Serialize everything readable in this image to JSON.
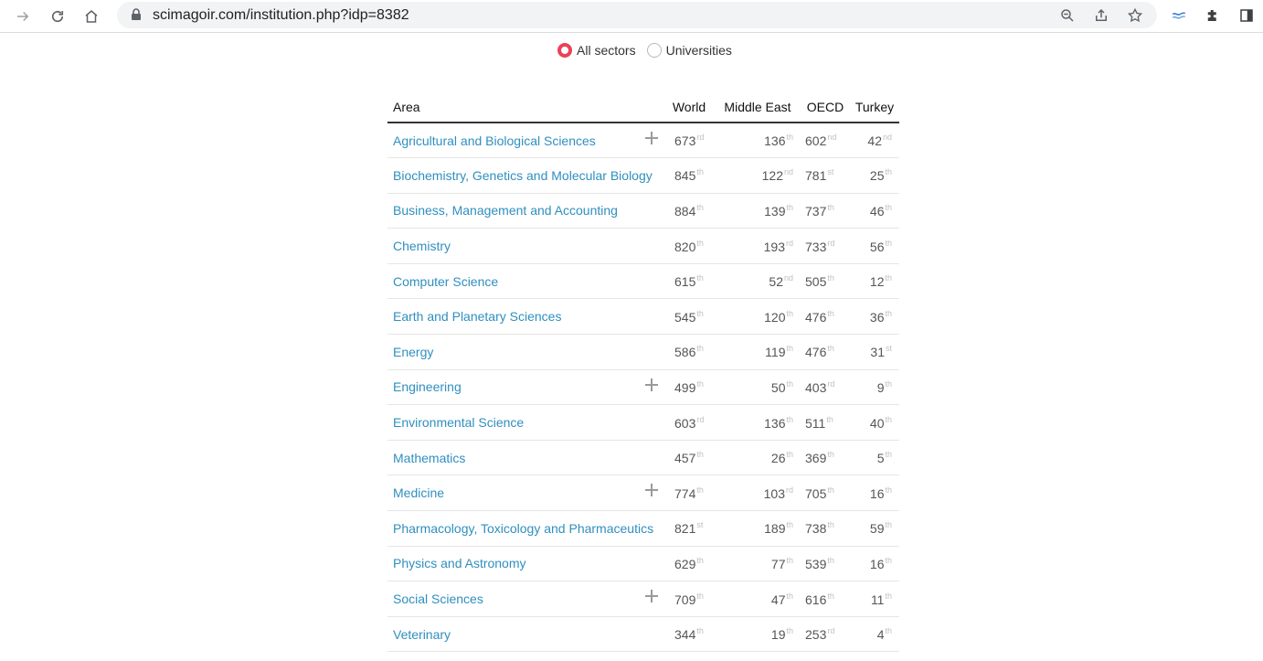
{
  "browser": {
    "url": "scimagoir.com/institution.php?idp=8382"
  },
  "filter": {
    "options": [
      {
        "label": "All sectors",
        "checked": true
      },
      {
        "label": "Universities",
        "checked": false
      }
    ]
  },
  "table": {
    "headers": {
      "area": "Area",
      "world": "World",
      "middle_east": "Middle East",
      "oecd": "OECD",
      "turkey": "Turkey"
    },
    "rows": [
      {
        "area": "Agricultural and Biological Sciences",
        "expand": true,
        "world": "673",
        "world_sfx": "rd",
        "me": "136",
        "me_sfx": "th",
        "oecd": "602",
        "oecd_sfx": "nd",
        "tr": "42",
        "tr_sfx": "nd"
      },
      {
        "area": "Biochemistry, Genetics and Molecular Biology",
        "expand": false,
        "world": "845",
        "world_sfx": "th",
        "me": "122",
        "me_sfx": "nd",
        "oecd": "781",
        "oecd_sfx": "st",
        "tr": "25",
        "tr_sfx": "th"
      },
      {
        "area": "Business, Management and Accounting",
        "expand": false,
        "world": "884",
        "world_sfx": "th",
        "me": "139",
        "me_sfx": "th",
        "oecd": "737",
        "oecd_sfx": "th",
        "tr": "46",
        "tr_sfx": "th"
      },
      {
        "area": "Chemistry",
        "expand": false,
        "world": "820",
        "world_sfx": "th",
        "me": "193",
        "me_sfx": "rd",
        "oecd": "733",
        "oecd_sfx": "rd",
        "tr": "56",
        "tr_sfx": "th"
      },
      {
        "area": "Computer Science",
        "expand": false,
        "world": "615",
        "world_sfx": "th",
        "me": "52",
        "me_sfx": "nd",
        "oecd": "505",
        "oecd_sfx": "th",
        "tr": "12",
        "tr_sfx": "th"
      },
      {
        "area": "Earth and Planetary Sciences",
        "expand": false,
        "world": "545",
        "world_sfx": "th",
        "me": "120",
        "me_sfx": "th",
        "oecd": "476",
        "oecd_sfx": "th",
        "tr": "36",
        "tr_sfx": "th"
      },
      {
        "area": "Energy",
        "expand": false,
        "world": "586",
        "world_sfx": "th",
        "me": "119",
        "me_sfx": "th",
        "oecd": "476",
        "oecd_sfx": "th",
        "tr": "31",
        "tr_sfx": "st"
      },
      {
        "area": "Engineering",
        "expand": true,
        "world": "499",
        "world_sfx": "th",
        "me": "50",
        "me_sfx": "th",
        "oecd": "403",
        "oecd_sfx": "rd",
        "tr": "9",
        "tr_sfx": "th"
      },
      {
        "area": "Environmental Science",
        "expand": false,
        "world": "603",
        "world_sfx": "rd",
        "me": "136",
        "me_sfx": "th",
        "oecd": "511",
        "oecd_sfx": "th",
        "tr": "40",
        "tr_sfx": "th"
      },
      {
        "area": "Mathematics",
        "expand": false,
        "world": "457",
        "world_sfx": "th",
        "me": "26",
        "me_sfx": "th",
        "oecd": "369",
        "oecd_sfx": "th",
        "tr": "5",
        "tr_sfx": "th"
      },
      {
        "area": "Medicine",
        "expand": true,
        "world": "774",
        "world_sfx": "th",
        "me": "103",
        "me_sfx": "rd",
        "oecd": "705",
        "oecd_sfx": "th",
        "tr": "16",
        "tr_sfx": "th"
      },
      {
        "area": "Pharmacology, Toxicology and Pharmaceutics",
        "expand": false,
        "world": "821",
        "world_sfx": "st",
        "me": "189",
        "me_sfx": "th",
        "oecd": "738",
        "oecd_sfx": "th",
        "tr": "59",
        "tr_sfx": "th"
      },
      {
        "area": "Physics and Astronomy",
        "expand": false,
        "world": "629",
        "world_sfx": "th",
        "me": "77",
        "me_sfx": "th",
        "oecd": "539",
        "oecd_sfx": "th",
        "tr": "16",
        "tr_sfx": "th"
      },
      {
        "area": "Social Sciences",
        "expand": true,
        "world": "709",
        "world_sfx": "th",
        "me": "47",
        "me_sfx": "th",
        "oecd": "616",
        "oecd_sfx": "th",
        "tr": "11",
        "tr_sfx": "th"
      },
      {
        "area": "Veterinary",
        "expand": false,
        "world": "344",
        "world_sfx": "th",
        "me": "19",
        "me_sfx": "th",
        "oecd": "253",
        "oecd_sfx": "rd",
        "tr": "4",
        "tr_sfx": "th"
      }
    ]
  },
  "colors": {
    "link": "#2f8fbf",
    "radio_accent": "#e8435a"
  }
}
